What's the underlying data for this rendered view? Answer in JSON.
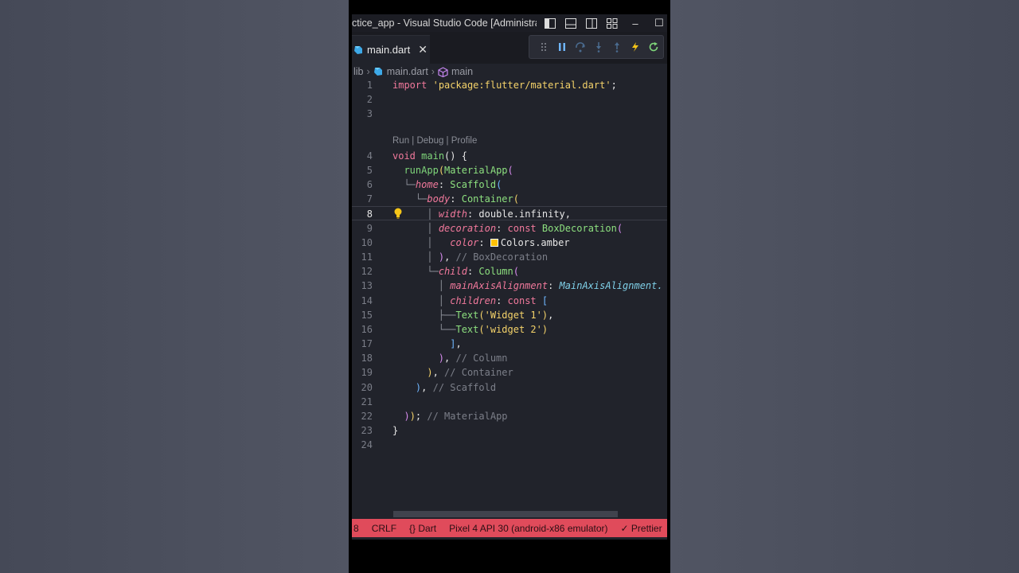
{
  "window": {
    "title": "ctice_app - Visual Studio Code [Administrator]"
  },
  "tab": {
    "label": "main.dart",
    "close": "✕"
  },
  "breadcrumb": {
    "folder": "lib",
    "file": "main.dart",
    "symbol": "main"
  },
  "codelens": "Run | Debug | Profile",
  "editor": {
    "current_line": 8,
    "line_numbers": [
      "1",
      "2",
      "3",
      "4",
      "5",
      "6",
      "7",
      "8",
      "9",
      "10",
      "11",
      "12",
      "13",
      "14",
      "15",
      "16",
      "17",
      "18",
      "19",
      "20",
      "21",
      "22",
      "23",
      "24"
    ]
  },
  "code": {
    "l1_kw": "import",
    "l1_str": "'package:flutter/material.dart'",
    "l1_end": ";",
    "l4_kw": "void",
    "l4_fn": "main",
    "l4_rest": "() {",
    "l5_fn": "runApp",
    "l5_cls": "MaterialApp",
    "l6_prop": "home",
    "l6_cls": "Scaffold",
    "l7_prop": "body",
    "l7_cls": "Container",
    "l8_prop": "width",
    "l8_val": "double.infinity",
    "l9_prop": "decoration",
    "l9_kw": "const",
    "l9_cls": "BoxDecoration",
    "l10_prop": "color",
    "l10_val": "Colors.amber",
    "l11_cmt": "// BoxDecoration",
    "l12_prop": "child",
    "l12_cls": "Column",
    "l13_prop": "mainAxisAlignment",
    "l13_val": "MainAxisAlignment.",
    "l14_prop": "children",
    "l14_kw": "const",
    "l15_cls": "Text",
    "l15_str": "'Widget 1'",
    "l16_cls": "Text",
    "l16_str": "'widget 2'",
    "l18_cmt": "// Column",
    "l19_cmt": "// Container",
    "l20_cmt": "// Scaffold",
    "l22_cmt": "// MaterialApp"
  },
  "statusbar": {
    "count": "8",
    "eol": "CRLF",
    "lang": "{} Dart",
    "device": "Pixel 4 API 30 (android-x86 emulator)",
    "prettier": "✓ Prettier"
  },
  "colors": {
    "statusbar": "#e04b5b",
    "swatch_amber": "#ffc107",
    "editor_bg": "#21232b"
  },
  "icons": [
    "dart-file-icon",
    "close-icon",
    "pause-icon",
    "step-over-icon",
    "step-into-icon",
    "step-out-icon",
    "hot-reload-icon",
    "restart-icon",
    "lightbulb-icon",
    "symbol-method-icon"
  ]
}
